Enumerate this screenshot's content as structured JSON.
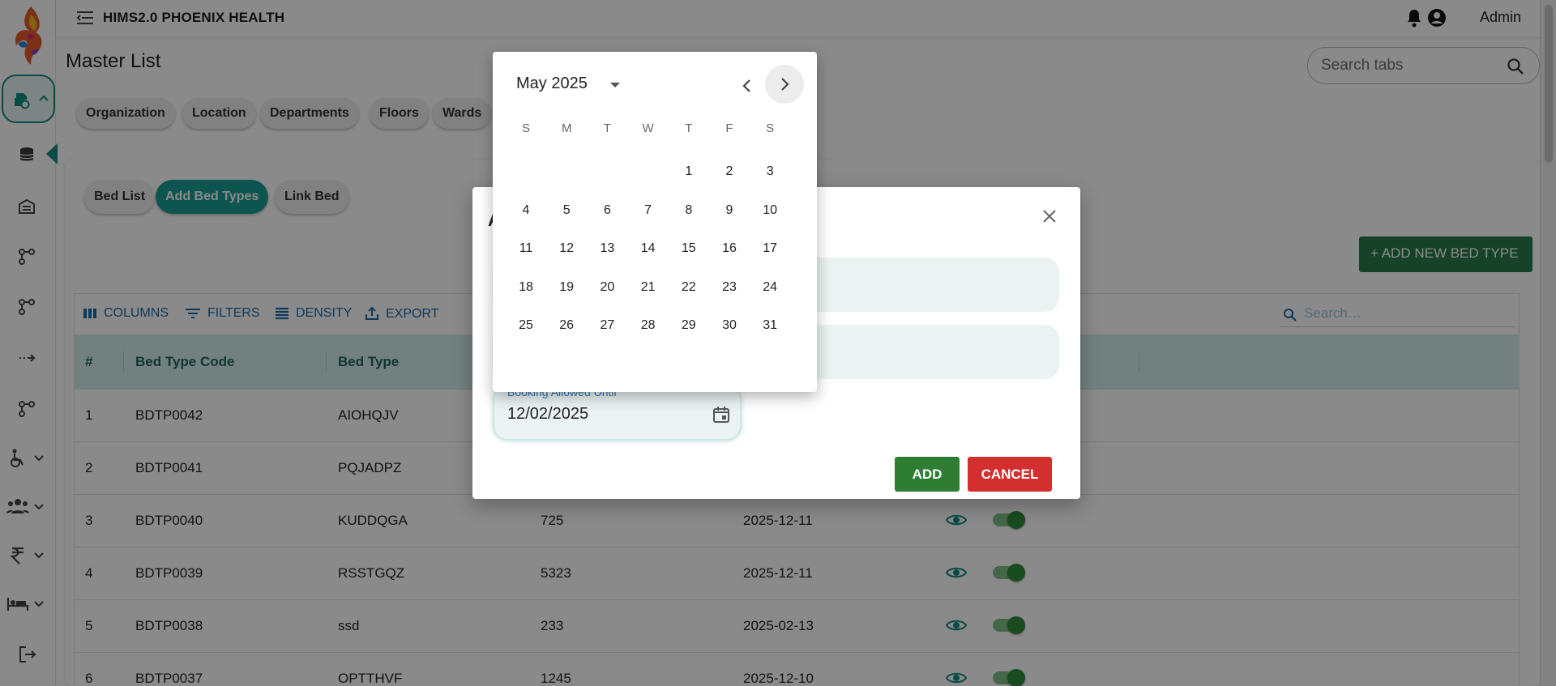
{
  "app": {
    "title": "HIMS2.0 PHOENIX HEALTH",
    "user": "Admin"
  },
  "page": {
    "title": "Master List",
    "search_placeholder": "Search tabs"
  },
  "master_tabs": [
    "Organization",
    "Location",
    "Departments",
    "Floors",
    "Wards"
  ],
  "sub_tabs": {
    "bed_list": "Bed List",
    "add_bed_types": "Add Bed Types",
    "link_bed": "Link Bed",
    "active": "Add Bed Types"
  },
  "add_new_label": "+ ADD NEW BED TYPE",
  "grid": {
    "toolbar": {
      "columns": "COLUMNS",
      "filters": "FILTERS",
      "density": "DENSITY",
      "export": "EXPORT",
      "search_placeholder": "Search…"
    },
    "headers": {
      "index": "#",
      "code": "Bed Type Code",
      "type": "Bed Type"
    },
    "rows": [
      {
        "index": "1",
        "code": "BDTP0042",
        "type": "AIOHQJV",
        "charge": "",
        "date": ""
      },
      {
        "index": "2",
        "code": "BDTP0041",
        "type": "PQJADPZ",
        "charge": "",
        "date": ""
      },
      {
        "index": "3",
        "code": "BDTP0040",
        "type": "KUDDQGA",
        "charge": "725",
        "date": "2025-12-11"
      },
      {
        "index": "4",
        "code": "BDTP0039",
        "type": "RSSTGQZ",
        "charge": "5323",
        "date": "2025-12-11"
      },
      {
        "index": "5",
        "code": "BDTP0038",
        "type": "ssd",
        "charge": "233",
        "date": "2025-02-13"
      },
      {
        "index": "6",
        "code": "BDTP0037",
        "type": "OPTTHVF",
        "charge": "1245",
        "date": "2025-12-10"
      }
    ]
  },
  "dialog": {
    "title_visible_fragment": "A",
    "booking_label": "Booking Allowed Until",
    "booking_value": "12/02/2025",
    "add_label": "ADD",
    "cancel_label": "CANCEL"
  },
  "datepicker": {
    "month_label": "May 2025",
    "weekdays": [
      "S",
      "M",
      "T",
      "W",
      "T",
      "F",
      "S"
    ],
    "first_weekday_index": 4,
    "days_in_month": 31
  },
  "colors": {
    "accent": "#1a9d94",
    "primary_green": "#2e7d32",
    "danger_red": "#d32f2f",
    "link_blue": "#1a6aa8",
    "header_bg": "#d2eceb"
  },
  "icons": {
    "menu": "menu-collapse-icon",
    "notifications": "bell-icon",
    "account": "account-circle-icon",
    "search": "search-icon",
    "close": "close-icon",
    "calendar": "calendar-icon",
    "view": "eye-icon"
  }
}
